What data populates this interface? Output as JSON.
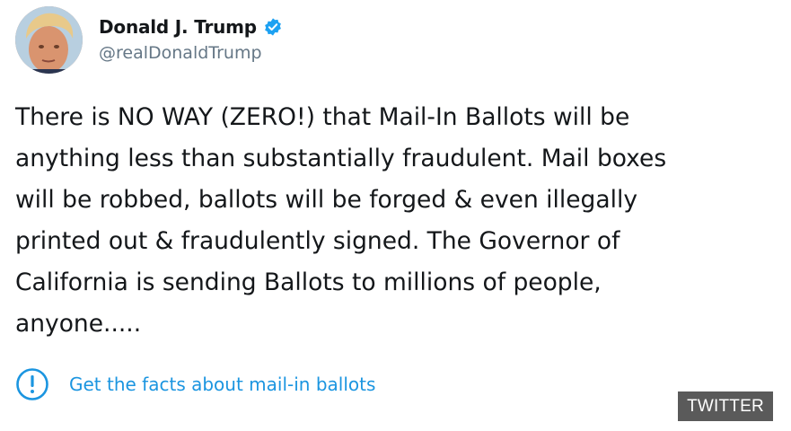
{
  "tweet": {
    "author": {
      "display_name": "Donald J. Trump",
      "handle": "@realDonaldTrump",
      "verified": true,
      "avatar_icon": "profile-photo"
    },
    "text_lines": [
      "There is NO WAY (ZERO!) that Mail-In Ballots will be",
      "anything less than substantially fraudulent. Mail boxes",
      "will be robbed, ballots will be forged & even illegally",
      "printed out & fraudulently signed. The Governor of",
      "California is sending Ballots to millions of people,",
      "anyone....."
    ],
    "fact_check": {
      "icon": "info-exclamation-icon",
      "label": "Get the facts about mail-in ballots"
    }
  },
  "watermark": {
    "label": "TWITTER"
  },
  "colors": {
    "link_blue": "#1b95e0",
    "verified_blue": "#1da1f2",
    "handle_gray": "#657786",
    "text_dark": "#14171a",
    "watermark_bg": "#5a5a5a"
  }
}
